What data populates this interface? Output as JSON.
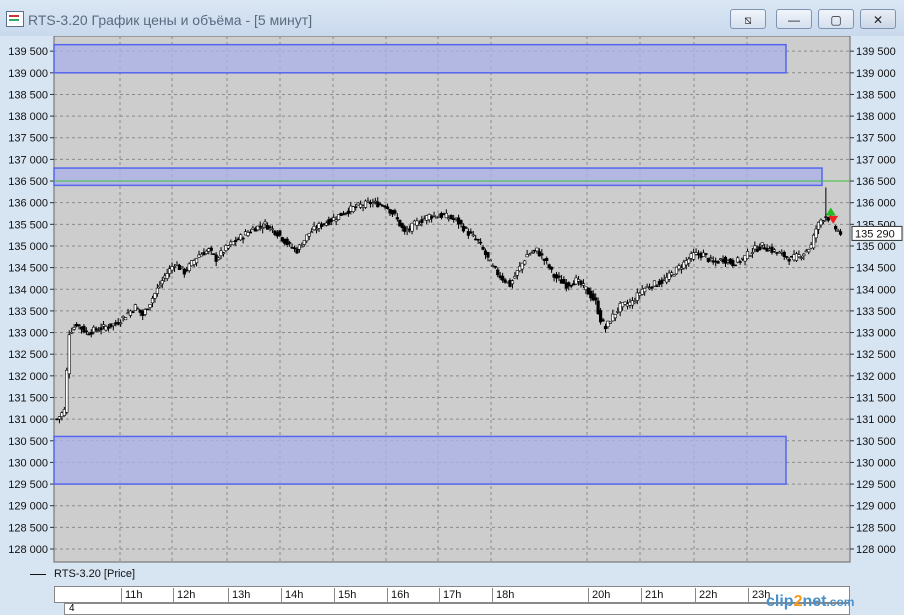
{
  "window": {
    "title": "RTS-3.20 График цены и объёма - [5 минут]",
    "buttons": {
      "tile": "⧅",
      "minimize": "—",
      "restore": "▢",
      "close": "✕"
    }
  },
  "chart_data": {
    "type": "candlestick",
    "instrument": "RTS-3.20",
    "ylim": [
      127700,
      139850
    ],
    "y_ticks": [
      "128 000",
      "128 500",
      "129 000",
      "129 500",
      "130 000",
      "130 500",
      "131 000",
      "131 500",
      "132 000",
      "132 500",
      "133 000",
      "133 500",
      "134 000",
      "134 500",
      "135 000",
      "135 500",
      "136 000",
      "136 500",
      "137 000",
      "137 500",
      "138 000",
      "138 500",
      "139 000",
      "139 500"
    ],
    "x_ticks": [
      "11h",
      "12h",
      "13h",
      "14h",
      "15h",
      "16h",
      "17h",
      "18h",
      "20h",
      "21h",
      "22h",
      "23h"
    ],
    "current_price_label": "135 290",
    "zones": [
      {
        "top": 139650,
        "bottom": 139000,
        "color": "#aab0e8"
      },
      {
        "top": 136800,
        "bottom": 136400,
        "color": "#aab0e8"
      },
      {
        "top": 130600,
        "bottom": 129500,
        "color": "#aab0e8"
      }
    ],
    "horizontal_line": {
      "value": 136500,
      "color": "#3cbf3c"
    },
    "close_path": [
      [
        0,
        131000
      ],
      [
        3,
        131200
      ],
      [
        5,
        133000
      ],
      [
        8,
        133200
      ],
      [
        12,
        133000
      ],
      [
        18,
        133100
      ],
      [
        24,
        133200
      ],
      [
        28,
        133400
      ],
      [
        32,
        133600
      ],
      [
        35,
        133400
      ],
      [
        40,
        133900
      ],
      [
        44,
        134300
      ],
      [
        48,
        134600
      ],
      [
        52,
        134400
      ],
      [
        55,
        134600
      ],
      [
        58,
        134800
      ],
      [
        62,
        134900
      ],
      [
        65,
        134700
      ],
      [
        70,
        135000
      ],
      [
        75,
        135200
      ],
      [
        80,
        135400
      ],
      [
        85,
        135500
      ],
      [
        90,
        135300
      ],
      [
        95,
        135000
      ],
      [
        98,
        134900
      ],
      [
        103,
        135300
      ],
      [
        108,
        135500
      ],
      [
        112,
        135600
      ],
      [
        118,
        135800
      ],
      [
        122,
        135900
      ],
      [
        128,
        136000
      ],
      [
        134,
        135950
      ],
      [
        138,
        135700
      ],
      [
        142,
        135300
      ],
      [
        146,
        135500
      ],
      [
        152,
        135700
      ],
      [
        158,
        135700
      ],
      [
        163,
        135600
      ],
      [
        168,
        135300
      ],
      [
        172,
        135100
      ],
      [
        175,
        134800
      ],
      [
        178,
        134500
      ],
      [
        181,
        134300
      ],
      [
        185,
        134100
      ],
      [
        188,
        134400
      ],
      [
        192,
        134800
      ],
      [
        196,
        134900
      ],
      [
        200,
        134600
      ],
      [
        203,
        134300
      ],
      [
        208,
        134100
      ],
      [
        212,
        134200
      ],
      [
        216,
        134000
      ],
      [
        220,
        133700
      ],
      [
        222,
        133300
      ],
      [
        224,
        133100
      ],
      [
        226,
        133300
      ],
      [
        230,
        133600
      ],
      [
        235,
        133700
      ],
      [
        239,
        134000
      ],
      [
        243,
        134100
      ],
      [
        248,
        134200
      ],
      [
        252,
        134400
      ],
      [
        256,
        134600
      ],
      [
        260,
        134800
      ],
      [
        264,
        134800
      ],
      [
        268,
        134600
      ],
      [
        272,
        134700
      ],
      [
        276,
        134600
      ],
      [
        280,
        134700
      ],
      [
        284,
        134900
      ],
      [
        288,
        135000
      ],
      [
        292,
        134900
      ],
      [
        296,
        134800
      ],
      [
        300,
        134700
      ],
      [
        304,
        134800
      ],
      [
        308,
        135000
      ],
      [
        310,
        135400
      ],
      [
        312,
        135600
      ],
      [
        314,
        135700
      ],
      [
        316,
        135600
      ],
      [
        318,
        135400
      ],
      [
        320,
        135290
      ]
    ],
    "signals": [
      {
        "index": 316,
        "price": 135750,
        "type": "buy",
        "color": "#22bb22"
      },
      {
        "index": 317,
        "price": 135650,
        "type": "sell",
        "color": "#ee2222"
      }
    ]
  },
  "legend": {
    "label": "RTS-3.20 [Price]"
  },
  "timebar": {
    "labels": [
      "11h",
      "12h",
      "13h",
      "14h",
      "15h",
      "16h",
      "17h",
      "18h",
      "20h",
      "21h",
      "22h",
      "23h"
    ]
  },
  "bottom_panel": {
    "label": "4"
  },
  "watermark": {
    "part1": "clip",
    "part2": "2",
    "part3": "net",
    "part4": ".com"
  }
}
